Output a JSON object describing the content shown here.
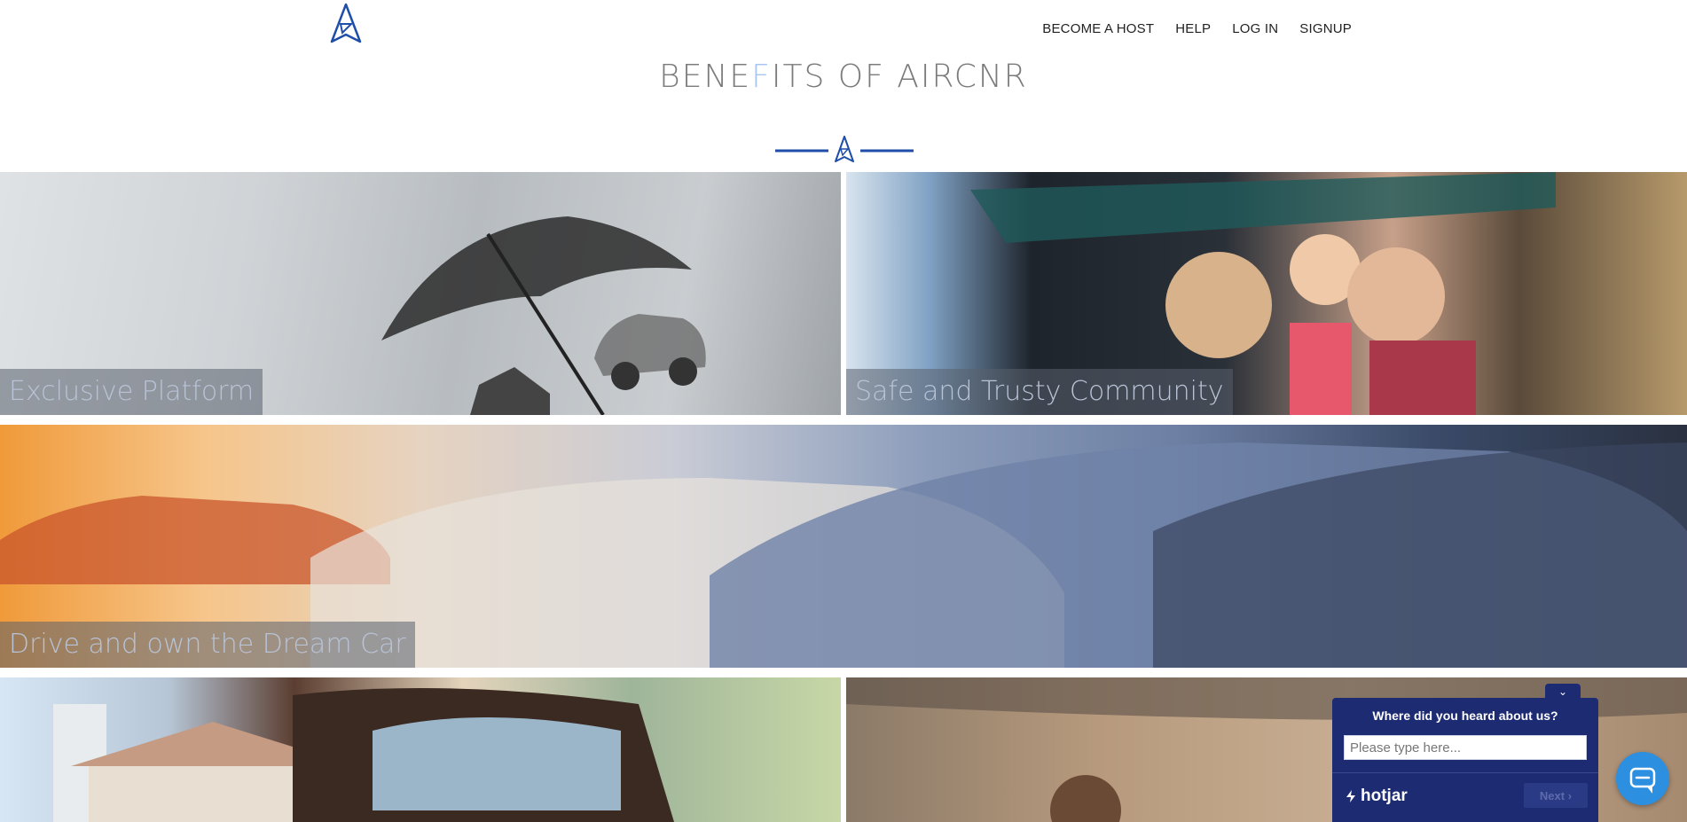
{
  "header": {
    "logo_icon": "aircnr-logo-icon",
    "nav": [
      {
        "label": "BECOME A HOST"
      },
      {
        "label": "HELP"
      },
      {
        "label": "LOG IN"
      },
      {
        "label": "SIGNUP"
      }
    ]
  },
  "main": {
    "title": "BENEFITS OF AIRCNR",
    "title_accent_color": "#a8c4f0",
    "brand_color": "#1f4ea8",
    "tiles": [
      {
        "caption": "Exclusive Platform"
      },
      {
        "caption": "Safe and Trusty Community"
      },
      {
        "caption": "Drive and own the Dream Car"
      },
      {
        "caption": ""
      },
      {
        "caption": ""
      }
    ]
  },
  "hotjar": {
    "question": "Where did you heard about us?",
    "placeholder": "Please type here...",
    "brand": "hotjar",
    "next_label": "Next",
    "toggle_icon": "chevron-down-icon"
  },
  "chat": {
    "icon": "chat-icon"
  }
}
